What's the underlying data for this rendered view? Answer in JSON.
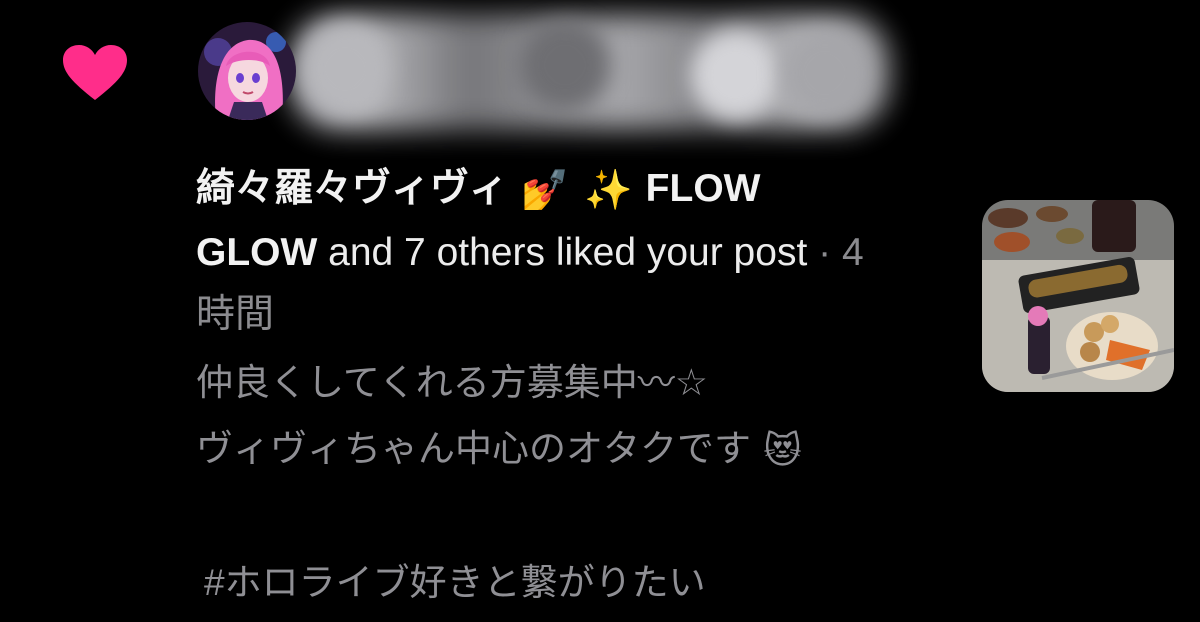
{
  "activity": {
    "type_icon": "heart-icon",
    "accent_color": "#ff2d8a"
  },
  "notification": {
    "user_name_1": "綺々羅々ヴィヴィ",
    "nail_emoji": "💅",
    "sparkles_emoji": "✨",
    "user_name_2": "FLOW GLOW",
    "action_text": "and 7 others liked your post",
    "separator": "·",
    "timestamp": "4時間"
  },
  "post": {
    "line1": "仲良くしてくれる方募集中〰☆",
    "line2": "ヴィヴィちゃん中心のオタクです",
    "line2_emoji": "😻",
    "hashtag": "#ホロライブ好きと繋がりたい"
  }
}
